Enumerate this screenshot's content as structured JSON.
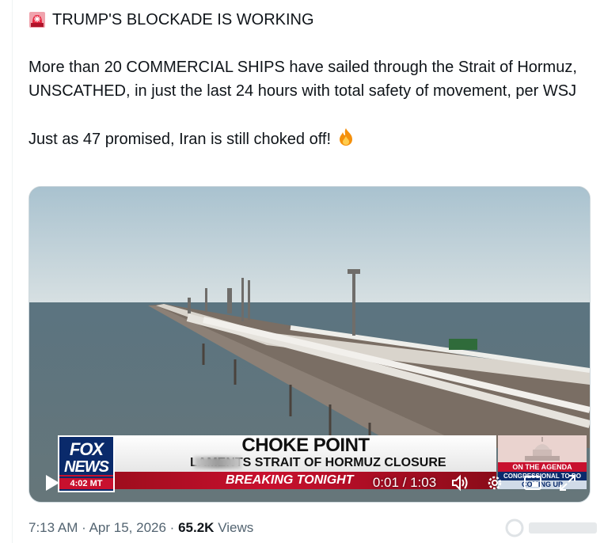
{
  "tweet": {
    "headline": "TRUMP'S BLOCKADE IS WORKING",
    "paragraph1": "More than 20 COMMERCIAL SHIPS have sailed through the Strait of Hormuz, UNSCATHED, in just the last 24 hours with total safety of movement, per WSJ",
    "paragraph2": "Just as 47 promised, Iran is still choked off!",
    "headline_icon": "rotating-light-icon",
    "closing_icon": "fire-icon"
  },
  "video": {
    "chyron": {
      "network_line1": "FOX",
      "network_line2": "NEWS",
      "clock": "4:02 MT",
      "title": "CHOKE POINT",
      "subtitle": "LAMENTS STRAIT OF HORMUZ CLOSURE",
      "breaking": "BREAKING TONIGHT",
      "agenda_line1": "ON THE AGENDA",
      "agenda_line2": "CONGRESSIONAL TO DO LIST",
      "agenda_line3": "COMING UP"
    },
    "time": "0:01 / 1:03",
    "controls": [
      "play-icon",
      "volume-icon",
      "settings-icon",
      "picture-in-picture-icon",
      "fullscreen-icon"
    ]
  },
  "meta": {
    "time": "7:13 AM",
    "separator": "·",
    "date": "Apr 15, 2026",
    "views_count": "65.2K",
    "views_label": "Views"
  },
  "colors": {
    "text": "#0f1419",
    "muted": "#536471",
    "fox_blue": "#0a2a6b",
    "fox_red": "#c8102e"
  }
}
